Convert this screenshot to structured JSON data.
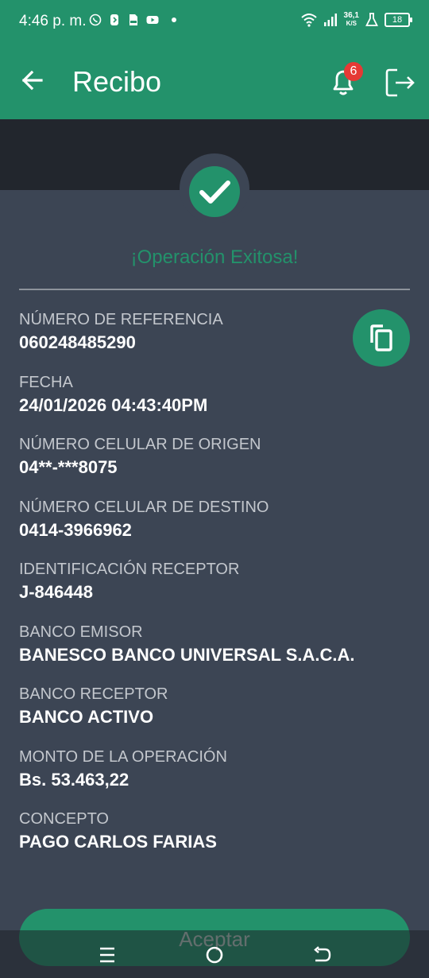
{
  "status_bar": {
    "time": "4:46 p. m.",
    "net_speed_value": "36,1",
    "net_speed_unit": "K/S",
    "battery": "18",
    "icons": [
      "whatsapp-icon",
      "app-icon",
      "pdf-icon",
      "youtube-icon",
      "dot-icon",
      "wifi-icon",
      "signal-icon",
      "flask-icon"
    ]
  },
  "app_bar": {
    "title": "Recibo",
    "notification_count": "6",
    "icons": [
      "back-arrow-icon",
      "bell-icon",
      "logout-icon"
    ]
  },
  "receipt": {
    "status_text": "¡Operación Exitosa!",
    "fields": [
      {
        "label": "NÚMERO DE REFERENCIA",
        "value": "060248485290"
      },
      {
        "label": "FECHA",
        "value": "24/01/2026 04:43:40PM"
      },
      {
        "label": "NÚMERO CELULAR DE ORIGEN",
        "value": "04**-***8075"
      },
      {
        "label": "NÚMERO CELULAR DE DESTINO",
        "value": "0414-3966962"
      },
      {
        "label": "IDENTIFICACIÓN RECEPTOR",
        "value": "J-846448"
      },
      {
        "label": "BANCO EMISOR",
        "value": "BANESCO BANCO UNIVERSAL S.A.C.A."
      },
      {
        "label": "BANCO RECEPTOR",
        "value": "BANCO ACTIVO"
      },
      {
        "label": "MONTO DE LA OPERACIÓN",
        "value": "Bs. 53.463,22"
      },
      {
        "label": "CONCEPTO",
        "value": "PAGO CARLOS FARIAS"
      }
    ]
  },
  "actions": {
    "accept_label": "Aceptar"
  },
  "colors": {
    "primary": "#23926b",
    "background": "#3c4554",
    "band": "#22262d"
  }
}
